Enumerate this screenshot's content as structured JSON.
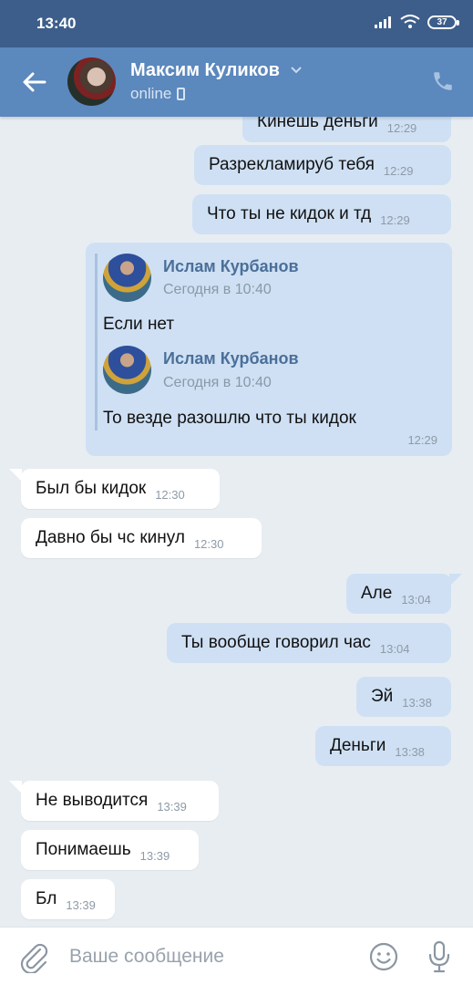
{
  "status_bar": {
    "time": "13:40",
    "battery": "37"
  },
  "header": {
    "name": "Максим Куликов",
    "status": "online"
  },
  "messages_top": [
    {
      "text": "Кинешь деньги",
      "time": "12:29"
    },
    {
      "text": "Разрекламируб тебя",
      "time": "12:29"
    },
    {
      "text": "Что ты не кидок и тд",
      "time": "12:29"
    }
  ],
  "forwarded": {
    "author": "Ислам Курбанов",
    "items": [
      {
        "date": "Сегодня в 10:40",
        "text": "Если нет"
      },
      {
        "date": "Сегодня в 10:40",
        "text": "То везде разошлю что ты кидок"
      }
    ],
    "time": "12:29"
  },
  "messages_bottom": [
    {
      "text": "Был бы кидок",
      "time": "12:30"
    },
    {
      "text": "Давно бы чс кинул",
      "time": "12:30"
    },
    {
      "text": "Але",
      "time": "13:04"
    },
    {
      "text": "Ты вообще говорил час",
      "time": "13:04"
    },
    {
      "text": "Эй",
      "time": "13:38"
    },
    {
      "text": "Деньги",
      "time": "13:38"
    },
    {
      "text": "Не выводится",
      "time": "13:39"
    },
    {
      "text": "Понимаешь",
      "time": "13:39"
    },
    {
      "text": "Бл",
      "time": "13:39"
    }
  ],
  "input": {
    "placeholder": "Ваше сообщение"
  },
  "colors": {
    "header": "#5b88bd",
    "status_bar": "#3d5e8a",
    "outgoing_bubble": "#cfe0f4",
    "incoming_bubble": "#ffffff",
    "background": "#e8edf2"
  }
}
